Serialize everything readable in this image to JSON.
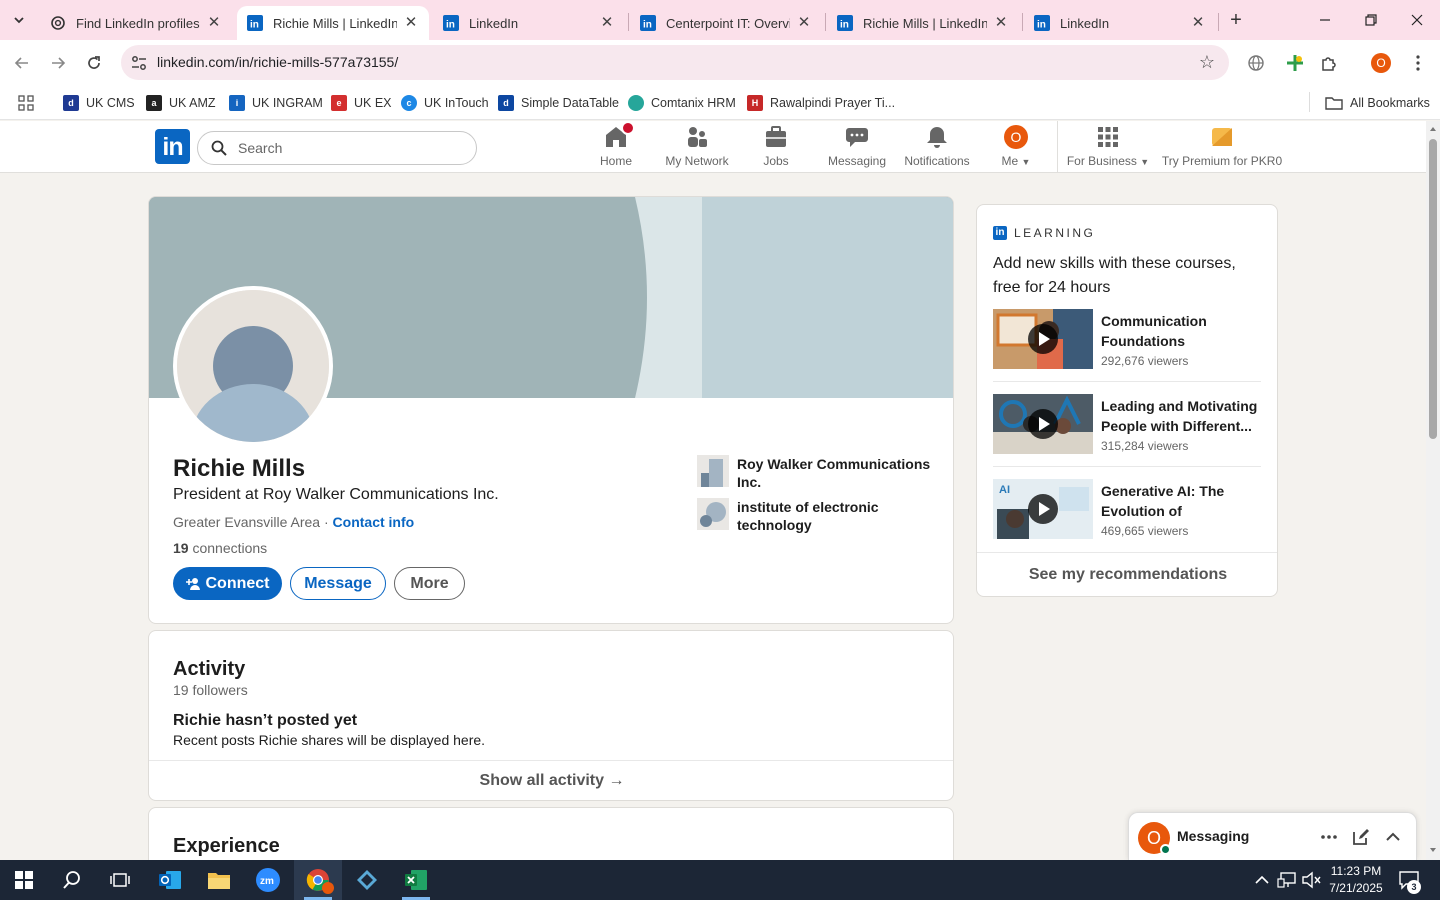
{
  "browser": {
    "tabs": [
      {
        "title": "Find LinkedIn profiles",
        "icon": "openai-icon",
        "active": false
      },
      {
        "title": "Richie Mills | LinkedIn",
        "icon": "linkedin-icon",
        "active": true
      },
      {
        "title": "LinkedIn",
        "icon": "linkedin-icon",
        "active": false
      },
      {
        "title": "Centerpoint IT: Overvie",
        "icon": "linkedin-icon",
        "active": false
      },
      {
        "title": "Richie Mills | LinkedIn",
        "icon": "linkedin-icon",
        "active": false
      },
      {
        "title": "LinkedIn",
        "icon": "linkedin-icon",
        "active": false
      }
    ],
    "url": "linkedin.com/in/richie-mills-577a73155/",
    "profile_initial": "O",
    "bookmarks": [
      {
        "label": "UK CMS",
        "color": "#1f3a93"
      },
      {
        "label": "UK AMZ",
        "color": "#222222"
      },
      {
        "label": "UK INGRAM",
        "color": "#1565c0"
      },
      {
        "label": "UK EX",
        "color": "#d32f2f"
      },
      {
        "label": "UK InTouch",
        "color": "#1e88e5"
      },
      {
        "label": "Simple DataTable",
        "color": "#0d47a1"
      },
      {
        "label": "Comtanix HRM",
        "color": "#26a69a"
      },
      {
        "label": "Rawalpindi Prayer Ti...",
        "color": "#c62828"
      }
    ],
    "all_bookmarks": "All Bookmarks"
  },
  "linkedin": {
    "logo": "in",
    "search_placeholder": "Search",
    "nav": {
      "home": "Home",
      "network": "My Network",
      "jobs": "Jobs",
      "messaging": "Messaging",
      "notifications": "Notifications",
      "me": "Me",
      "me_initial": "O",
      "business": "For Business",
      "premium": "Try Premium for PKR0"
    }
  },
  "profile": {
    "name": "Richie Mills",
    "headline": "President at Roy Walker Communications Inc.",
    "location": "Greater Evansville Area",
    "separator": " · ",
    "contact": "Contact info",
    "connections_count": "19",
    "connections_label": " connections",
    "buttons": {
      "connect": "Connect",
      "message": "Message",
      "more": "More"
    },
    "orgs": [
      {
        "name": "Roy Walker Communications Inc."
      },
      {
        "name": "institute of electronic technology"
      }
    ]
  },
  "activity": {
    "title": "Activity",
    "followers": "19 followers",
    "empty_title": "Richie hasn’t posted yet",
    "empty_body": "Recent posts Richie shares will be displayed here.",
    "show_all": "Show all activity →"
  },
  "experience": {
    "title": "Experience"
  },
  "learning": {
    "label": "LEARNING",
    "subtitle": "Add new skills with these courses, free for 24 hours",
    "courses": [
      {
        "title": "Communication Foundations",
        "viewers": "292,676 viewers"
      },
      {
        "title": "Leading and Motivating People with Different...",
        "viewers": "315,284 viewers"
      },
      {
        "title": "Generative AI: The Evolution of Thoughtfu...",
        "viewers": "469,665 viewers"
      }
    ],
    "see_more": "See my recommendations"
  },
  "messaging_dock": {
    "title": "Messaging",
    "initial": "O"
  },
  "taskbar": {
    "time": "11:23 PM",
    "date": "7/21/2025",
    "notifications": "3"
  },
  "colors": {
    "linkedin_blue": "#0a66c2",
    "tab_strip": "#fbe0ea",
    "profile_orange": "#e8580c",
    "banner": "#a0b4b7"
  }
}
